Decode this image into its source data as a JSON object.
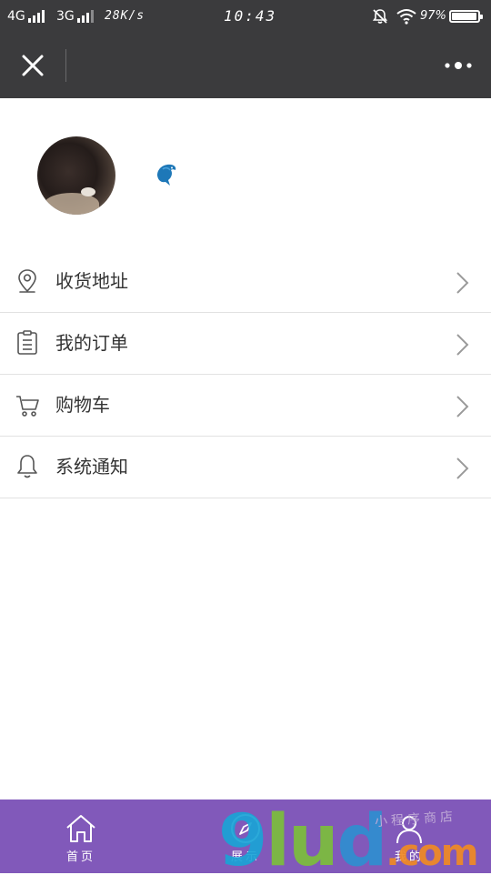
{
  "status_bar": {
    "network1": "4G",
    "network2": "3G",
    "speed": "28K/s",
    "time": "10:43",
    "battery_text": "97%",
    "battery_level": 0.97
  },
  "title_bar": {
    "close_icon": "close-icon",
    "more_icon": "more-dots-icon"
  },
  "profile": {
    "avatar_icon": "avatar",
    "badge_icon": "dolphin-icon"
  },
  "menu": {
    "items": [
      {
        "label": "收货地址",
        "icon": "location-pin-icon"
      },
      {
        "label": "我的订单",
        "icon": "clipboard-list-icon"
      },
      {
        "label": "购物车",
        "icon": "cart-icon"
      },
      {
        "label": "系统通知",
        "icon": "bell-icon"
      }
    ]
  },
  "bottom_nav": {
    "items": [
      {
        "label": "首页",
        "icon": "home-icon"
      },
      {
        "label": "展示",
        "icon": "compass-icon"
      },
      {
        "label": "我的",
        "icon": "user-icon"
      }
    ]
  },
  "watermark": {
    "logo": "9lud.com",
    "logo_parts": [
      "9",
      "lu",
      "d",
      ".com"
    ],
    "text": "小程序商店"
  },
  "colors": {
    "header_bg": "#3b3b3d",
    "nav_bg": "#8159ba",
    "text": "#333333",
    "divider": "#e2e2e2"
  }
}
